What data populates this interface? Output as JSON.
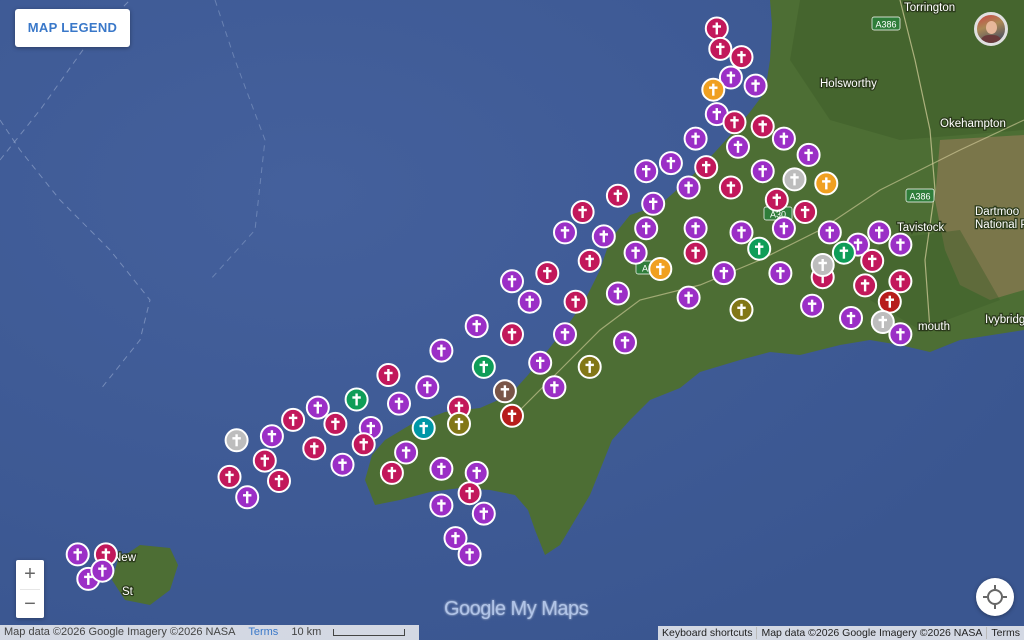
{
  "legend": {
    "label": "MAP LEGEND"
  },
  "zoom": {
    "in_label": "+",
    "out_label": "−"
  },
  "places": [
    {
      "name": "Torrington"
    },
    {
      "name": "Holsworthy"
    },
    {
      "name": "Okehampton"
    },
    {
      "name": "Tavistock"
    },
    {
      "name": "Dartmoor National Park",
      "lines": [
        "Dartmoo",
        "National P"
      ]
    },
    {
      "name": "Ivybridge"
    },
    {
      "name": "mouth"
    },
    {
      "name": "New"
    },
    {
      "name": "St"
    }
  ],
  "roads": [
    "A386",
    "A30",
    "A386",
    "A30"
  ],
  "attribution_left": {
    "map_data": "Map data ©2026 Google Imagery ©2026 NASA",
    "terms": "Terms",
    "scale": "10 km"
  },
  "attribution_right": {
    "shortcuts": "Keyboard shortcuts",
    "map_data": "Map data ©2026 Google Imagery ©2026 NASA",
    "terms": "Terms"
  },
  "logo": {
    "google": "Google",
    "product": " My Maps"
  },
  "colors": {
    "sea": "#3e5a96",
    "land": "#4d6e34",
    "land_dark": "#3f5f2a",
    "moor": "#8a7a52",
    "purple": "#9b2fc6",
    "magenta": "#c2185b",
    "gray": "#bdbdbd",
    "orange": "#f0a020",
    "green": "#0f9d58",
    "teal": "#0097a7",
    "olive": "#827717",
    "brown": "#795548",
    "darkred": "#b71c1c"
  },
  "marker_icon": "cross-icon",
  "markers": [
    {
      "lat": -4.52,
      "lng": 51.05,
      "color": "magenta"
    },
    {
      "lat": -4.51,
      "lng": 51.0,
      "color": "magenta"
    },
    {
      "lat": -4.45,
      "lng": 50.98,
      "color": "magenta"
    },
    {
      "lat": -4.48,
      "lng": 50.93,
      "color": "purple"
    },
    {
      "lat": -4.41,
      "lng": 50.91,
      "color": "purple"
    },
    {
      "lat": -4.53,
      "lng": 50.9,
      "color": "orange"
    },
    {
      "lat": -4.52,
      "lng": 50.84,
      "color": "purple"
    },
    {
      "lat": -4.47,
      "lng": 50.82,
      "color": "magenta"
    },
    {
      "lat": -4.39,
      "lng": 50.81,
      "color": "magenta"
    },
    {
      "lat": -4.58,
      "lng": 50.78,
      "color": "purple"
    },
    {
      "lat": -4.33,
      "lng": 50.78,
      "color": "purple"
    },
    {
      "lat": -4.26,
      "lng": 50.74,
      "color": "purple"
    },
    {
      "lat": -4.46,
      "lng": 50.76,
      "color": "purple"
    },
    {
      "lat": -4.65,
      "lng": 50.72,
      "color": "purple"
    },
    {
      "lat": -4.72,
      "lng": 50.7,
      "color": "purple"
    },
    {
      "lat": -4.55,
      "lng": 50.71,
      "color": "magenta"
    },
    {
      "lat": -4.39,
      "lng": 50.7,
      "color": "purple"
    },
    {
      "lat": -4.3,
      "lng": 50.68,
      "color": "gray"
    },
    {
      "lat": -4.21,
      "lng": 50.67,
      "color": "orange"
    },
    {
      "lat": -4.6,
      "lng": 50.66,
      "color": "purple"
    },
    {
      "lat": -4.48,
      "lng": 50.66,
      "color": "magenta"
    },
    {
      "lat": -4.35,
      "lng": 50.63,
      "color": "magenta"
    },
    {
      "lat": -4.27,
      "lng": 50.6,
      "color": "magenta"
    },
    {
      "lat": -4.8,
      "lng": 50.64,
      "color": "magenta"
    },
    {
      "lat": -4.9,
      "lng": 50.6,
      "color": "magenta"
    },
    {
      "lat": -4.7,
      "lng": 50.62,
      "color": "purple"
    },
    {
      "lat": -4.95,
      "lng": 50.55,
      "color": "purple"
    },
    {
      "lat": -4.84,
      "lng": 50.54,
      "color": "purple"
    },
    {
      "lat": -4.72,
      "lng": 50.56,
      "color": "purple"
    },
    {
      "lat": -4.58,
      "lng": 50.56,
      "color": "purple"
    },
    {
      "lat": -4.45,
      "lng": 50.55,
      "color": "purple"
    },
    {
      "lat": -4.33,
      "lng": 50.56,
      "color": "purple"
    },
    {
      "lat": -4.2,
      "lng": 50.55,
      "color": "purple"
    },
    {
      "lat": -4.12,
      "lng": 50.52,
      "color": "purple"
    },
    {
      "lat": -4.4,
      "lng": 50.51,
      "color": "green"
    },
    {
      "lat": -4.58,
      "lng": 50.5,
      "color": "magenta"
    },
    {
      "lat": -4.75,
      "lng": 50.5,
      "color": "purple"
    },
    {
      "lat": -4.88,
      "lng": 50.48,
      "color": "magenta"
    },
    {
      "lat": -5.0,
      "lng": 50.45,
      "color": "magenta"
    },
    {
      "lat": -5.1,
      "lng": 50.43,
      "color": "purple"
    },
    {
      "lat": -4.68,
      "lng": 50.46,
      "color": "orange"
    },
    {
      "lat": -4.5,
      "lng": 50.45,
      "color": "purple"
    },
    {
      "lat": -4.34,
      "lng": 50.45,
      "color": "purple"
    },
    {
      "lat": -4.22,
      "lng": 50.44,
      "color": "magenta"
    },
    {
      "lat": -4.1,
      "lng": 50.42,
      "color": "magenta"
    },
    {
      "lat": -5.05,
      "lng": 50.38,
      "color": "purple"
    },
    {
      "lat": -4.92,
      "lng": 50.38,
      "color": "magenta"
    },
    {
      "lat": -4.8,
      "lng": 50.4,
      "color": "purple"
    },
    {
      "lat": -4.6,
      "lng": 50.39,
      "color": "purple"
    },
    {
      "lat": -4.45,
      "lng": 50.36,
      "color": "olive"
    },
    {
      "lat": -4.25,
      "lng": 50.37,
      "color": "purple"
    },
    {
      "lat": -4.14,
      "lng": 50.34,
      "color": "purple"
    },
    {
      "lat": -5.2,
      "lng": 50.32,
      "color": "purple"
    },
    {
      "lat": -5.1,
      "lng": 50.3,
      "color": "magenta"
    },
    {
      "lat": -4.95,
      "lng": 50.3,
      "color": "purple"
    },
    {
      "lat": -4.78,
      "lng": 50.28,
      "color": "purple"
    },
    {
      "lat": -5.3,
      "lng": 50.26,
      "color": "purple"
    },
    {
      "lat": -5.18,
      "lng": 50.22,
      "color": "green"
    },
    {
      "lat": -5.02,
      "lng": 50.23,
      "color": "purple"
    },
    {
      "lat": -4.88,
      "lng": 50.22,
      "color": "olive"
    },
    {
      "lat": -5.45,
      "lng": 50.2,
      "color": "magenta"
    },
    {
      "lat": -5.34,
      "lng": 50.17,
      "color": "purple"
    },
    {
      "lat": -5.12,
      "lng": 50.16,
      "color": "brown"
    },
    {
      "lat": -4.98,
      "lng": 50.17,
      "color": "purple"
    },
    {
      "lat": -5.54,
      "lng": 50.14,
      "color": "green"
    },
    {
      "lat": -5.42,
      "lng": 50.13,
      "color": "purple"
    },
    {
      "lat": -5.25,
      "lng": 50.12,
      "color": "magenta"
    },
    {
      "lat": -5.1,
      "lng": 50.1,
      "color": "darkred"
    },
    {
      "lat": -5.65,
      "lng": 50.12,
      "color": "purple"
    },
    {
      "lat": -5.72,
      "lng": 50.09,
      "color": "magenta"
    },
    {
      "lat": -5.6,
      "lng": 50.08,
      "color": "magenta"
    },
    {
      "lat": -5.5,
      "lng": 50.07,
      "color": "purple"
    },
    {
      "lat": -5.35,
      "lng": 50.07,
      "color": "teal"
    },
    {
      "lat": -5.25,
      "lng": 50.08,
      "color": "olive"
    },
    {
      "lat": -5.78,
      "lng": 50.05,
      "color": "purple"
    },
    {
      "lat": -5.88,
      "lng": 50.04,
      "color": "gray"
    },
    {
      "lat": -5.66,
      "lng": 50.02,
      "color": "magenta"
    },
    {
      "lat": -5.52,
      "lng": 50.03,
      "color": "magenta"
    },
    {
      "lat": -5.4,
      "lng": 50.01,
      "color": "purple"
    },
    {
      "lat": -5.8,
      "lng": 49.99,
      "color": "magenta"
    },
    {
      "lat": -5.58,
      "lng": 49.98,
      "color": "purple"
    },
    {
      "lat": -5.44,
      "lng": 49.96,
      "color": "magenta"
    },
    {
      "lat": -5.3,
      "lng": 49.97,
      "color": "purple"
    },
    {
      "lat": -5.9,
      "lng": 49.95,
      "color": "magenta"
    },
    {
      "lat": -5.76,
      "lng": 49.94,
      "color": "magenta"
    },
    {
      "lat": -5.2,
      "lng": 49.96,
      "color": "purple"
    },
    {
      "lat": -5.85,
      "lng": 49.9,
      "color": "purple"
    },
    {
      "lat": -5.22,
      "lng": 49.91,
      "color": "magenta"
    },
    {
      "lat": -5.3,
      "lng": 49.88,
      "color": "purple"
    },
    {
      "lat": -5.18,
      "lng": 49.86,
      "color": "purple"
    },
    {
      "lat": -5.26,
      "lng": 49.8,
      "color": "purple"
    },
    {
      "lat": -5.22,
      "lng": 49.76,
      "color": "purple"
    },
    {
      "lat": -6.33,
      "lng": 49.76,
      "color": "purple"
    },
    {
      "lat": -6.25,
      "lng": 49.76,
      "color": "magenta"
    },
    {
      "lat": -6.3,
      "lng": 49.7,
      "color": "purple"
    },
    {
      "lat": -6.26,
      "lng": 49.72,
      "color": "purple"
    },
    {
      "lat": -4.22,
      "lng": 50.47,
      "color": "gray"
    },
    {
      "lat": -4.16,
      "lng": 50.5,
      "color": "green"
    },
    {
      "lat": -4.08,
      "lng": 50.48,
      "color": "magenta"
    },
    {
      "lat": -4.0,
      "lng": 50.43,
      "color": "magenta"
    },
    {
      "lat": -4.03,
      "lng": 50.38,
      "color": "darkred"
    },
    {
      "lat": -4.05,
      "lng": 50.33,
      "color": "gray"
    },
    {
      "lat": -4.0,
      "lng": 50.3,
      "color": "purple"
    },
    {
      "lat": -4.06,
      "lng": 50.55,
      "color": "purple"
    },
    {
      "lat": -4.0,
      "lng": 50.52,
      "color": "purple"
    }
  ]
}
